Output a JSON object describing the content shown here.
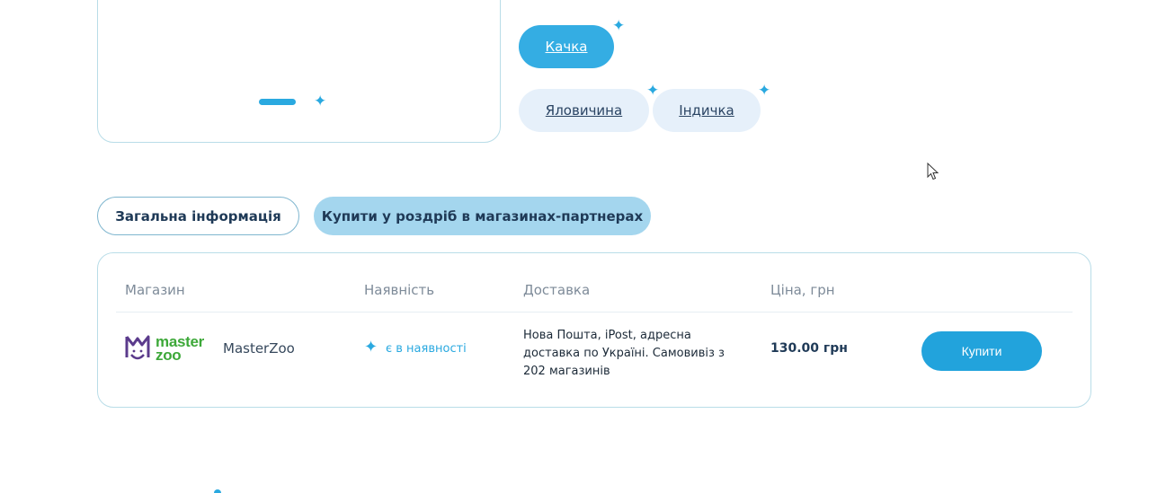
{
  "flavors": {
    "active": "Качка",
    "inactive": [
      "Яловичина",
      "Індичка"
    ]
  },
  "tabs": {
    "general_info": "Загальна інформація",
    "buy_retail": "Купити у роздріб в магазинах-партнерах"
  },
  "stores_table": {
    "headers": {
      "store": "Магазин",
      "availability": "Наявність",
      "delivery": "Доставка",
      "price": "Ціна, грн"
    },
    "rows": [
      {
        "logo_text_line1": "master",
        "logo_text_line2": "zoo",
        "name": "MasterZoo",
        "availability": "є в наявності",
        "delivery": "Нова Пошта, iPost, адресна доставка по Україні. Самовивіз з 202 магазинів",
        "price": "130.00 грн",
        "buy_label": "Купити"
      }
    ]
  },
  "colors": {
    "accent": "#2aa9e0",
    "active_chip": "#34ade3",
    "inactive_chip": "#e6f0fa",
    "tab_filled": "#a4d6ee",
    "logo_green": "#3da839",
    "logo_purple": "#5b3b8c"
  },
  "icons": {
    "sparkle": "four-point-star",
    "cursor": "mouse-pointer"
  }
}
